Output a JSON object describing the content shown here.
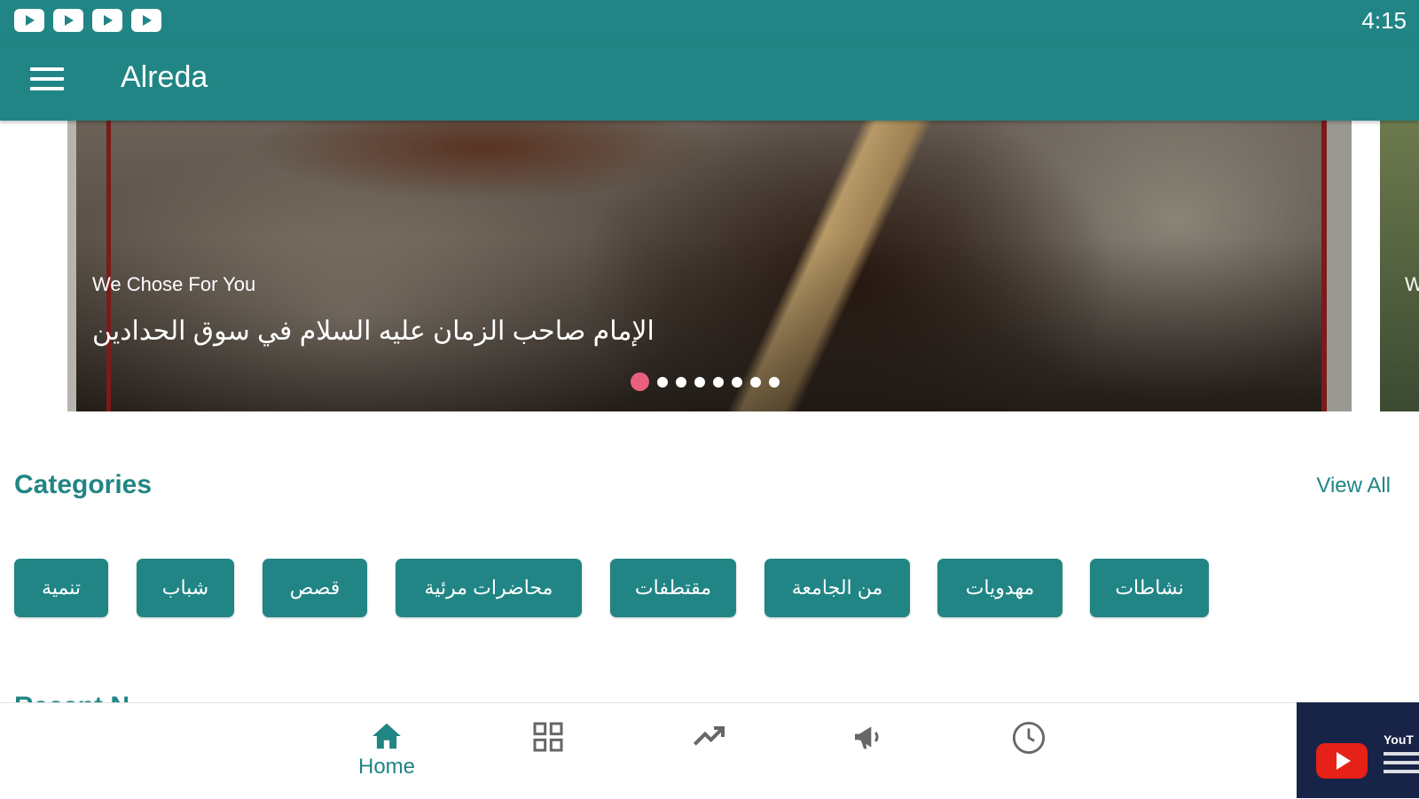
{
  "status_bar": {
    "time": "4:15",
    "notifications": [
      "youtube-icon",
      "youtube-icon",
      "youtube-icon",
      "youtube-icon"
    ]
  },
  "app_bar": {
    "title": "Alreda",
    "menu_icon": "menu-icon"
  },
  "carousel": {
    "label": "We Chose For You",
    "title": "الإمام صاحب الزمان عليه السلام في سوق الحدادين",
    "next_label": "W",
    "dots_total": 8,
    "active_index": 0,
    "active_dot_color": "#e8607c"
  },
  "categories": {
    "title": "Categories",
    "view_all": "View All",
    "items": [
      "تنمية",
      "شباب",
      "قصص",
      "محاضرات مرئية",
      "مقتطفات",
      "من الجامعة",
      "مهدويات",
      "نشاطات"
    ]
  },
  "next_section_title": "Recent N",
  "bottom_nav": {
    "items": [
      {
        "icon": "home-icon",
        "label": "Home",
        "active": true
      },
      {
        "icon": "grid-icon",
        "label": "",
        "active": false
      },
      {
        "icon": "trending-icon",
        "label": "",
        "active": false
      },
      {
        "icon": "megaphone-icon",
        "label": "",
        "active": false
      },
      {
        "icon": "clock-icon",
        "label": "",
        "active": false
      }
    ]
  },
  "overlay": {
    "text": "YouT"
  },
  "colors": {
    "primary": "#218585",
    "background": "#ffffff",
    "accent": "#e8607c",
    "youtube_red": "#e62117"
  }
}
